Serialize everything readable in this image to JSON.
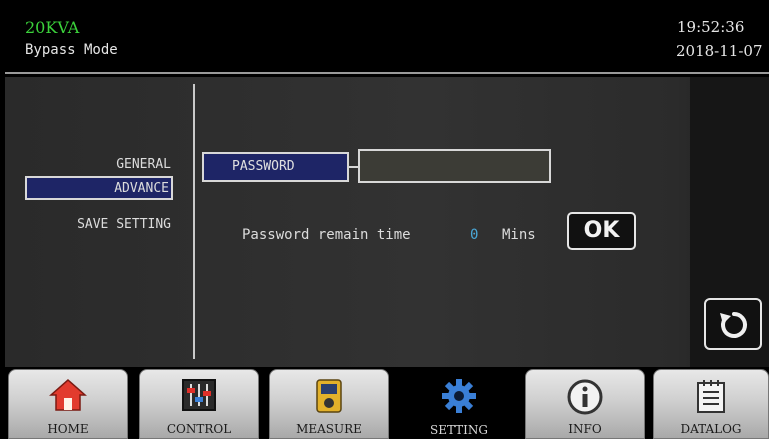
{
  "header": {
    "model": "20KVA",
    "mode": "Bypass Mode",
    "time": "19:52:36",
    "date": "2018-11-07"
  },
  "menu": {
    "general": "GENERAL",
    "advance": "ADVANCE",
    "save_setting": "SAVE SETTING",
    "selected": "ADVANCE"
  },
  "password": {
    "label": "PASSWORD",
    "value": "",
    "remain_text": "Password remain time",
    "remain_value": "0",
    "remain_unit": "Mins",
    "ok_label": "OK"
  },
  "nav": {
    "items": [
      {
        "label": "HOME",
        "icon": "home-icon"
      },
      {
        "label": "CONTROL",
        "icon": "sliders-icon"
      },
      {
        "label": "MEASURE",
        "icon": "meter-icon"
      },
      {
        "label": "SETTING",
        "icon": "gear-icon",
        "active": true
      },
      {
        "label": "INFO",
        "icon": "info-icon"
      },
      {
        "label": "DATALOG",
        "icon": "log-icon"
      }
    ]
  },
  "colors": {
    "model_text": "#3bd23b",
    "selected_fill": "#1e2566",
    "remain_value": "#4aa8d8",
    "gear": "#3a7fd6"
  }
}
